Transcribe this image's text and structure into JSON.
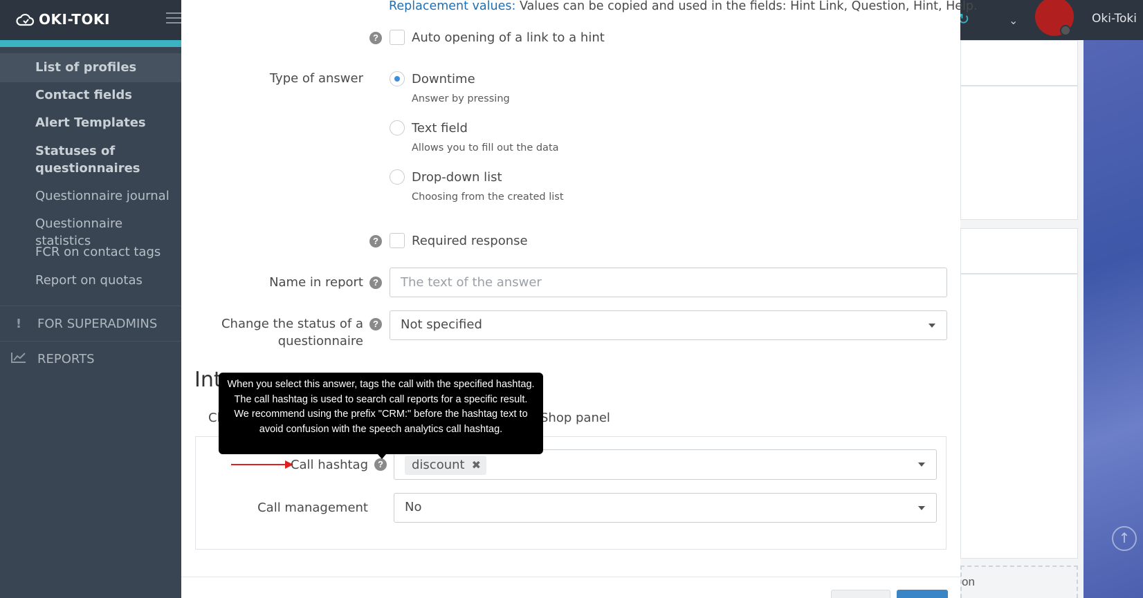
{
  "header": {
    "logo_text": "OKI-TOKI",
    "user_name": "Oki-Toki",
    "accent_color": "#3bb3c3",
    "avatar_color": "#b21f1f"
  },
  "sidebar": {
    "items": [
      {
        "label": "List of profiles"
      },
      {
        "label": "Contact fields"
      },
      {
        "label": "Alert Templates"
      },
      {
        "label": "Statuses of questionnaires"
      },
      {
        "label": "Questionnaire journal"
      },
      {
        "label": "Questionnaire statistics"
      },
      {
        "label": "FCR on contact tags"
      },
      {
        "label": "Report on quotas"
      }
    ],
    "sections": [
      {
        "label": "FOR SUPERADMINS",
        "icon": "exclamation-icon"
      },
      {
        "label": "REPORTS",
        "icon": "chart-line-icon"
      }
    ]
  },
  "background": {
    "partial_text": "on"
  },
  "modal": {
    "replacement": {
      "link": "Replacement values:",
      "text": " Values can be copied and used in the fields: Hint Link, Question, Hint, Help."
    },
    "auto_open_label": "Auto opening of a link to a hint",
    "type_of_answer_label": "Type of answer",
    "answer_types": [
      {
        "label": "Downtime",
        "hint": "Answer by pressing",
        "selected": true
      },
      {
        "label": "Text field",
        "hint": "Allows you to fill out the data",
        "selected": false
      },
      {
        "label": "Drop-down list",
        "hint": "Choosing from the created list",
        "selected": false
      }
    ],
    "required_label": "Required response",
    "name_in_report": {
      "label": "Name in report",
      "placeholder": "The text of the answer"
    },
    "change_status": {
      "label": "Change the status of a questionnaire",
      "value": "Not specified"
    },
    "section_title_partial": "Int",
    "tabs": [
      {
        "label": "Cl"
      },
      {
        "label": "Shop panel"
      }
    ],
    "call_hashtag": {
      "label": "Call hashtag",
      "tags": [
        "discount"
      ]
    },
    "call_management": {
      "label": "Call management",
      "value": "No"
    },
    "tooltip_text": "When you select this answer, tags the call with the specified hashtag. The call hashtag is used to search call reports for a specific result. We recommend using the prefix \"CRM:\" before the hashtag text to avoid confusion with the speech analytics call hashtag.",
    "arrow_color": "#e02020",
    "radio_color": "#3a8edb"
  }
}
